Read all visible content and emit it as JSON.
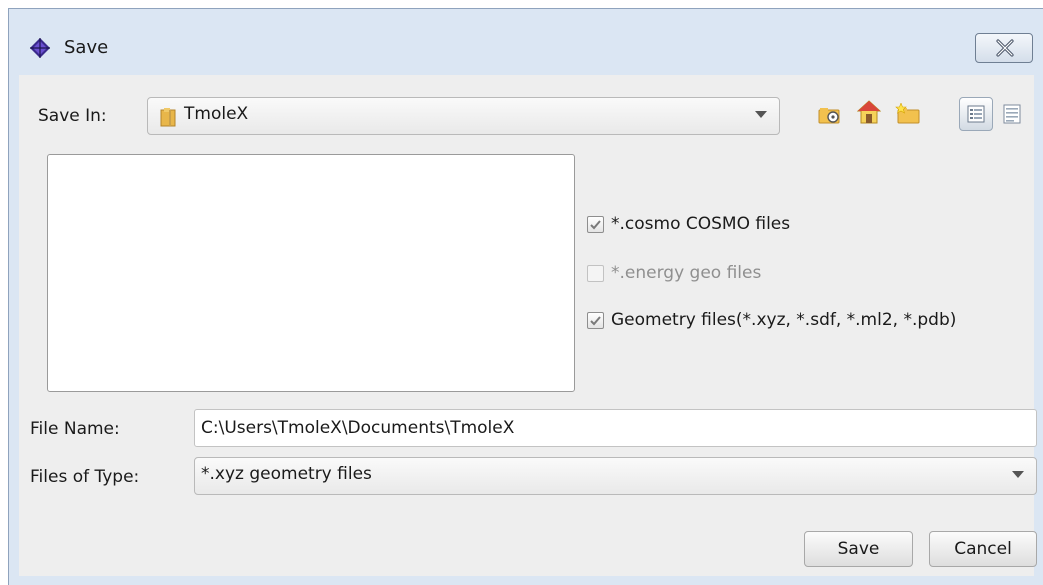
{
  "window": {
    "title": "Save"
  },
  "save_in": {
    "label": "Save In:",
    "value": "TmoleX"
  },
  "toolbar": {
    "up_one_level": "folder-up-icon",
    "home": "home-icon",
    "new_folder": "new-folder-icon",
    "list_view": "list-view-icon",
    "details_view": "details-view-icon"
  },
  "options": [
    {
      "label": "*.cosmo COSMO files",
      "checked": true,
      "enabled": true
    },
    {
      "label": "*.energy geo files",
      "checked": false,
      "enabled": false
    },
    {
      "label": "Geometry files(*.xyz, *.sdf, *.ml2, *.pdb)",
      "checked": true,
      "enabled": true
    }
  ],
  "file_name": {
    "label": "File Name:",
    "value": "C:\\Users\\TmoleX\\Documents\\TmoleX"
  },
  "file_type": {
    "label": "Files of Type:",
    "value": "*.xyz geometry files"
  },
  "buttons": {
    "save": "Save",
    "cancel": "Cancel"
  },
  "colors": {
    "titlebar": "#dbe6f3",
    "panel": "#eeeeee",
    "check": "#7a7a7a"
  }
}
